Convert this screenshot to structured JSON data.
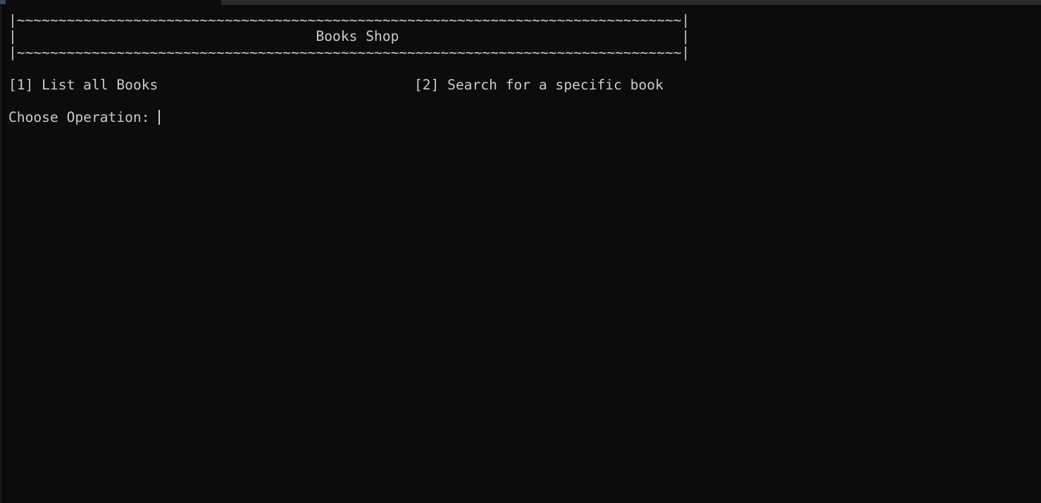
{
  "terminal": {
    "background": "#0c0c0c",
    "foreground": "#cccccc",
    "banner": {
      "top": "|~~~~~~~~~~~~~~~~~~~~~~~~~~~~~~~~~~~~~~~~~~~~~~~~~~~~~~~~~~~~~~~~~~~~~~~~~~~~~~~~|",
      "title_line": "|                                    Books Shop                                  |",
      "bottom": "|~~~~~~~~~~~~~~~~~~~~~~~~~~~~~~~~~~~~~~~~~~~~~~~~~~~~~~~~~~~~~~~~~~~~~~~~~~~~~~~~|"
    },
    "options": [
      {
        "label": "[1] List all Books"
      },
      {
        "label": "[2] Search for a specific book"
      }
    ],
    "prompt": {
      "text": "Choose Operation: ",
      "input_value": ""
    }
  }
}
